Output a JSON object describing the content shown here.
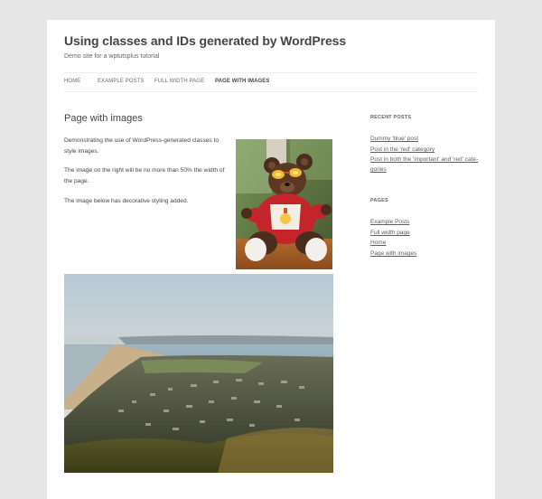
{
  "site": {
    "title": "Using classes and IDs generated by WordPress",
    "description": "Demo site for a wptutsplus tutorial"
  },
  "nav": {
    "items": [
      {
        "label": "HOME"
      },
      {
        "label": "EXAMPLE POSTS"
      },
      {
        "label": "FULL WIDTH PAGE"
      },
      {
        "label": "PAGE WITH IMAGES",
        "current": true
      }
    ]
  },
  "entry": {
    "title": "Page with images",
    "paragraph1": "Demonstrating the use of WordPress-generated classes to style images.",
    "paragraph2": "The image on the right will be no more than 50% the width of the page.",
    "paragraph3": "The image below has decorative styling added."
  },
  "sidebar": {
    "recent_posts": {
      "title": "RECENT POSTS",
      "items": [
        {
          "label": "Dummy 'blue' post"
        },
        {
          "label": "Post in the 'red' category"
        },
        {
          "label": "Post in both the 'important' and 'red' cate-"
        },
        {
          "label": "gories"
        }
      ]
    },
    "pages": {
      "title": "PAGES",
      "items": [
        {
          "label": "Example Posts"
        },
        {
          "label": "Full width page"
        },
        {
          "label": "Home"
        },
        {
          "label": "Page with images"
        }
      ]
    }
  },
  "colors": {
    "background": "#e6e6e6",
    "page": "#ffffff",
    "text": "#444444"
  }
}
